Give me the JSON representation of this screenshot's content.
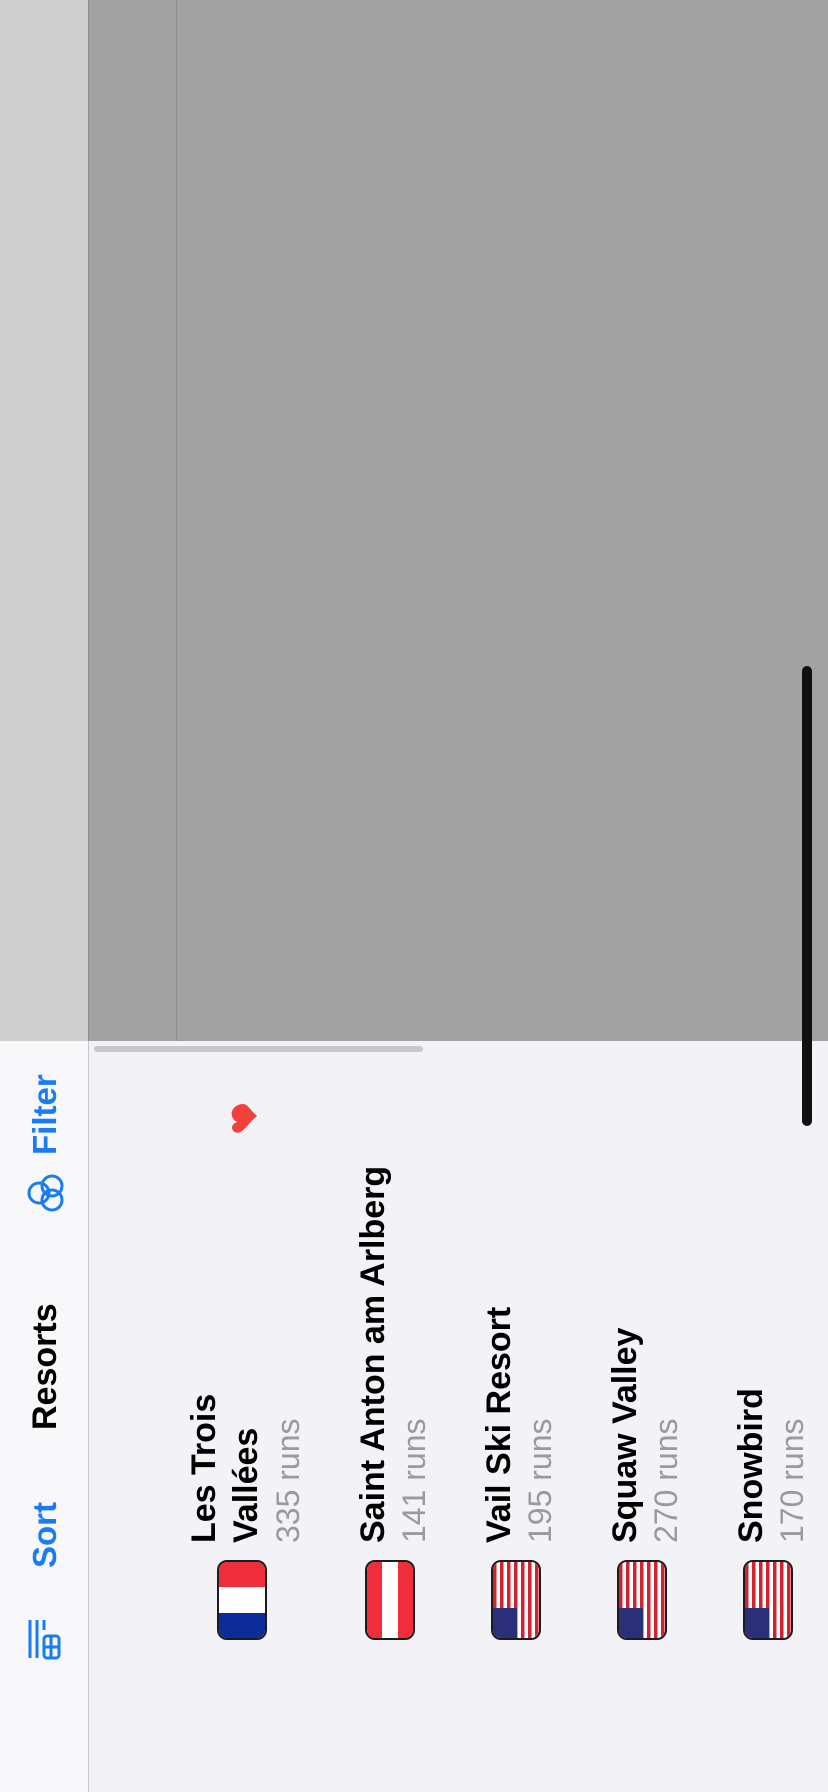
{
  "nav": {
    "title": "Resorts",
    "sort_label": "Sort",
    "filter_label": "Filter",
    "sort_icon": "sort-list-icon",
    "filter_icon": "filter-circles-icon"
  },
  "resorts": [
    {
      "name_line1": "Les Trois",
      "name_line2": "Vallées",
      "runs": "335 runs",
      "flag": "france-flag-icon",
      "favorite": true
    },
    {
      "name": "Saint Anton am Arlberg",
      "runs": "141 runs",
      "flag": "austria-flag-icon"
    },
    {
      "name": "Vail Ski Resort",
      "runs": "195 runs",
      "flag": "usa-flag-icon"
    },
    {
      "name": "Squaw Valley",
      "runs": "270 runs",
      "flag": "usa-flag-icon"
    },
    {
      "name": "Snowbird",
      "runs": "170 runs",
      "flag": "usa-flag-icon"
    }
  ],
  "colors": {
    "accent": "#1a7cf5",
    "favorite": "#f2403a",
    "detail_bg": "#a2a2a2",
    "list_bg": "#f2f2f7"
  }
}
